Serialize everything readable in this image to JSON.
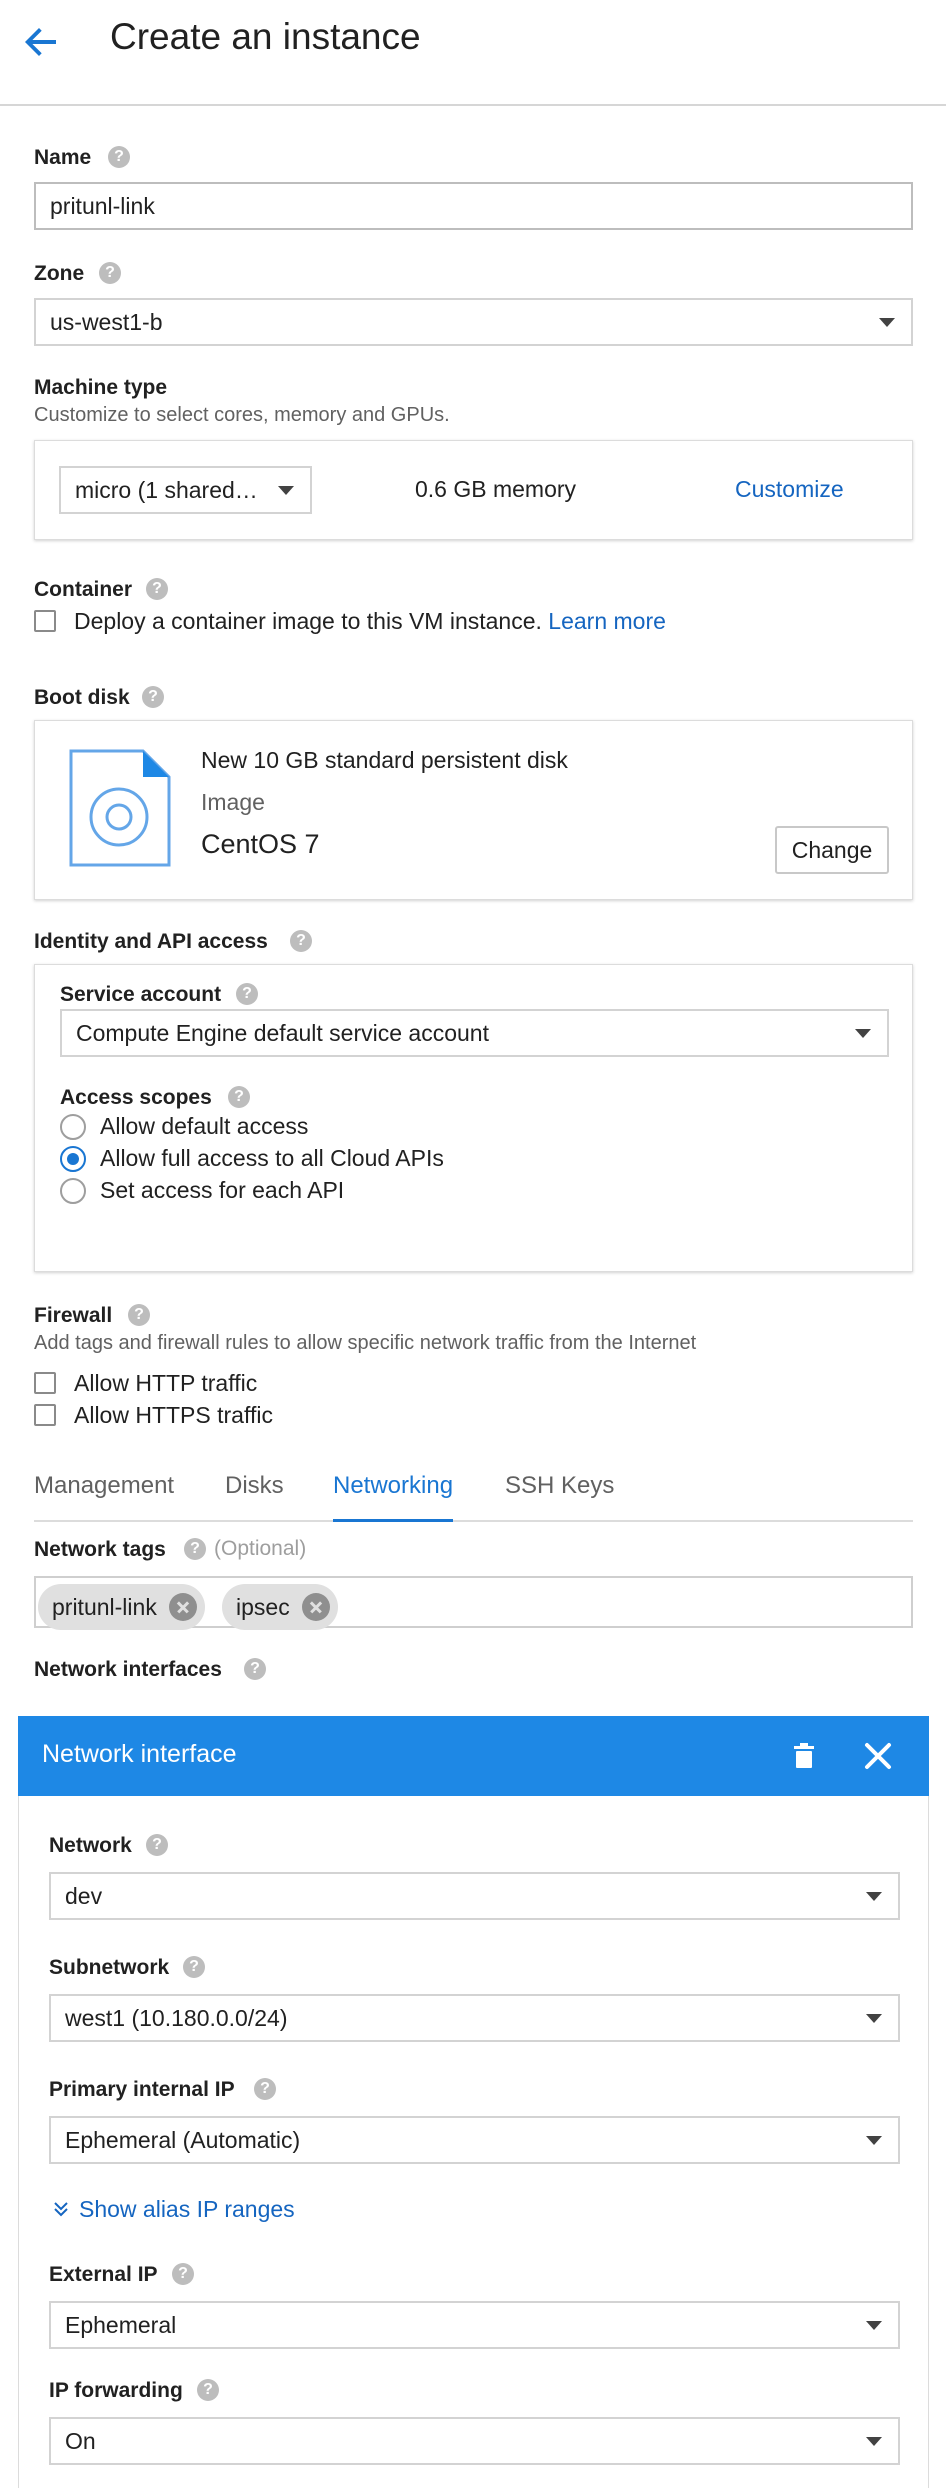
{
  "header": {
    "title": "Create an instance"
  },
  "name": {
    "label": "Name",
    "value": "pritunl-link"
  },
  "zone": {
    "label": "Zone",
    "value": "us-west1-b"
  },
  "machine_type": {
    "label": "Machine type",
    "description": "Customize to select cores, memory and GPUs.",
    "selected": "micro (1 shared…",
    "memory": "0.6 GB memory",
    "customize_label": "Customize"
  },
  "container": {
    "label": "Container",
    "checkbox_label": "Deploy a container image to this VM instance.",
    "learn_more": "Learn more"
  },
  "boot_disk": {
    "label": "Boot disk",
    "disk_title": "New 10 GB standard persistent disk",
    "image_label": "Image",
    "image_value": "CentOS 7",
    "change_label": "Change"
  },
  "identity": {
    "label": "Identity and API access",
    "service_account_label": "Service account",
    "service_account_value": "Compute Engine default service account",
    "access_scopes_label": "Access scopes",
    "scopes": [
      {
        "label": "Allow default access",
        "checked": false
      },
      {
        "label": "Allow full access to all Cloud APIs",
        "checked": true
      },
      {
        "label": "Set access for each API",
        "checked": false
      }
    ]
  },
  "firewall": {
    "label": "Firewall",
    "description": "Add tags and firewall rules to allow specific network traffic from the Internet",
    "options": [
      {
        "label": "Allow HTTP traffic",
        "checked": false
      },
      {
        "label": "Allow HTTPS traffic",
        "checked": false
      }
    ]
  },
  "tabs": [
    {
      "label": "Management",
      "active": false
    },
    {
      "label": "Disks",
      "active": false
    },
    {
      "label": "Networking",
      "active": true
    },
    {
      "label": "SSH Keys",
      "active": false
    }
  ],
  "network_tags": {
    "label": "Network tags",
    "optional": "(Optional)",
    "tags": [
      "pritunl-link",
      "ipsec"
    ]
  },
  "network_interfaces": {
    "label": "Network interfaces"
  },
  "network_interface": {
    "title": "Network interface",
    "network_label": "Network",
    "network_value": "dev",
    "subnetwork_label": "Subnetwork",
    "subnetwork_value": "west1 (10.180.0.0/24)",
    "primary_ip_label": "Primary internal IP",
    "primary_ip_value": "Ephemeral (Automatic)",
    "alias_link": "Show alias IP ranges",
    "external_ip_label": "External IP",
    "external_ip_value": "Ephemeral",
    "ip_forwarding_label": "IP forwarding",
    "ip_forwarding_value": "On"
  },
  "help_glyph": "?",
  "colors": {
    "accent": "#1976d2",
    "header_blue": "#1e88e5",
    "link": "#1565c0"
  }
}
